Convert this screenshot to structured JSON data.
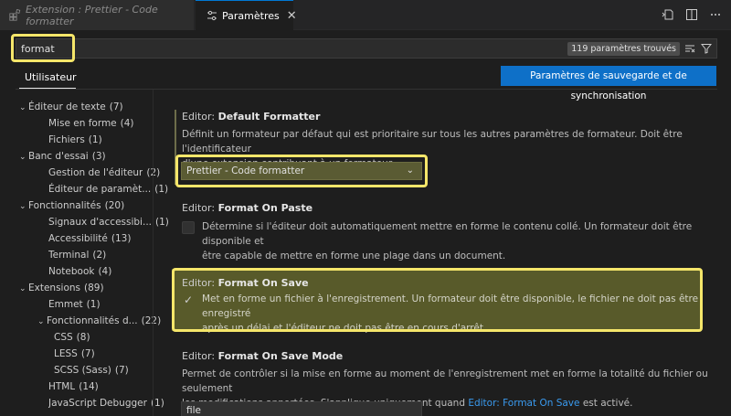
{
  "tabs": [
    {
      "label": "Extension : Prettier - Code formatter",
      "active": false
    },
    {
      "label": "Paramètres",
      "active": true
    }
  ],
  "search": {
    "value": "format",
    "placeholder": "",
    "results_label": "119 paramètres trouvés"
  },
  "scope": {
    "user_tab": "Utilisateur",
    "sync_button": "Paramètres de sauvegarde et de synchronisation"
  },
  "toc": [
    {
      "label": "Éditeur de texte",
      "count": "(7)",
      "level": 1,
      "expanded": true
    },
    {
      "label": "Mise en forme",
      "count": "(4)",
      "level": 2
    },
    {
      "label": "Fichiers",
      "count": "(1)",
      "level": 2
    },
    {
      "label": "Banc d'essai",
      "count": "(3)",
      "level": 1,
      "expanded": true
    },
    {
      "label": "Gestion de l'éditeur",
      "count": "(2)",
      "level": 2
    },
    {
      "label": "Éditeur de paramèt...",
      "count": "(1)",
      "level": 2
    },
    {
      "label": "Fonctionnalités",
      "count": "(20)",
      "level": 1,
      "expanded": true
    },
    {
      "label": "Signaux d'accessibi...",
      "count": "(1)",
      "level": 2
    },
    {
      "label": "Accessibilité",
      "count": "(13)",
      "level": 2
    },
    {
      "label": "Terminal",
      "count": "(2)",
      "level": 2
    },
    {
      "label": "Notebook",
      "count": "(4)",
      "level": 2
    },
    {
      "label": "Extensions",
      "count": "(89)",
      "level": 1,
      "expanded": true
    },
    {
      "label": "Emmet",
      "count": "(1)",
      "level": 2
    },
    {
      "label": "Fonctionnalités d...",
      "count": "(22)",
      "level": 2,
      "expanded": true
    },
    {
      "label": "CSS",
      "count": "(8)",
      "level": 3
    },
    {
      "label": "LESS",
      "count": "(7)",
      "level": 3
    },
    {
      "label": "SCSS (Sass)",
      "count": "(7)",
      "level": 3
    },
    {
      "label": "HTML",
      "count": "(14)",
      "level": 2
    },
    {
      "label": "JavaScript Debugger",
      "count": "(1)",
      "level": 2
    }
  ],
  "settings": {
    "default_formatter": {
      "category": "Editor:",
      "name": "Default Formatter",
      "desc1": "Définit un formateur par défaut qui est prioritaire sur tous les autres paramètres de formateur. Doit être l'identificateur",
      "desc2": "d'une extension contribuant à un formateur.",
      "value": "Prettier - Code formatter"
    },
    "format_on_paste": {
      "category": "Editor:",
      "name": "Format On Paste",
      "desc1": "Détermine si l'éditeur doit automatiquement mettre en forme le contenu collé. Un formateur doit être disponible et",
      "desc2": "être capable de mettre en forme une plage dans un document.",
      "checked": false
    },
    "format_on_save": {
      "category": "Editor:",
      "name": "Format On Save",
      "desc1": "Met en forme un fichier à l'enregistrement. Un formateur doit être disponible, le fichier ne doit pas être enregistré",
      "desc2": "après un délai et l'éditeur ne doit pas être en cours d'arrêt.",
      "checked": true
    },
    "format_on_save_mode": {
      "category": "Editor:",
      "name": "Format On Save Mode",
      "desc1": "Permet de contrôler si la mise en forme au moment de l'enregistrement met en forme la totalité du fichier ou seulement",
      "desc2_pre": "les modifications apportées. S'applique uniquement quand",
      "desc2_link": "Editor: Format On Save",
      "desc2_post": "est activé.",
      "value": "file"
    }
  },
  "colors": {
    "accent": "#0078d4",
    "highlight": "#f5e66a",
    "link": "#3a9bf0"
  }
}
